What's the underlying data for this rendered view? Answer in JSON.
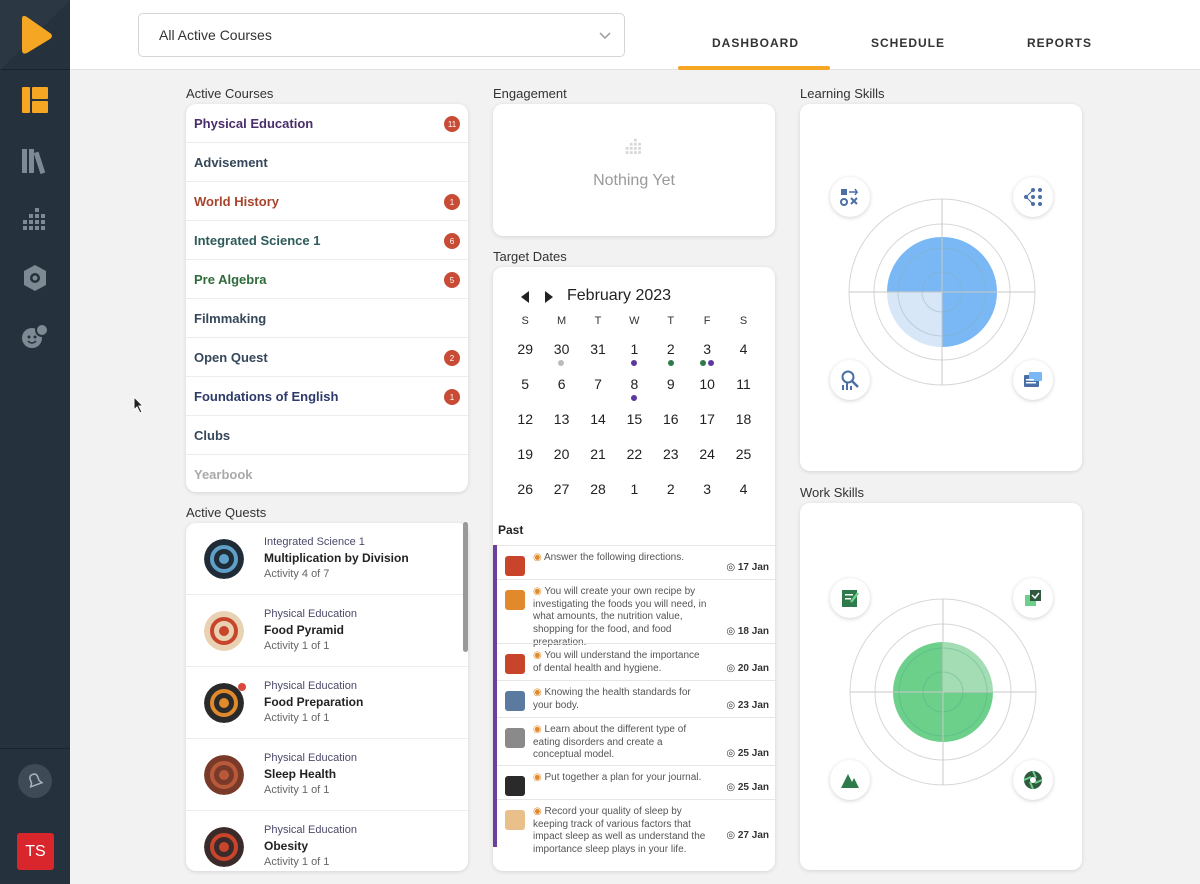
{
  "header": {
    "course_select": "All Active Courses",
    "tabs": [
      {
        "label": "DASHBOARD",
        "active": true
      },
      {
        "label": "SCHEDULE",
        "active": false
      },
      {
        "label": "REPORTS",
        "active": false
      }
    ]
  },
  "sidebar": {
    "avatar_initials": "TS",
    "icons": [
      "dashboard-icon",
      "library-icon",
      "analytics-icon",
      "badge-icon",
      "students-icon",
      "notifications-icon"
    ]
  },
  "active_courses": {
    "title": "Active Courses",
    "items": [
      {
        "name": "Physical Education",
        "badge": "11",
        "color": "#4a2d6a"
      },
      {
        "name": "Advisement",
        "badge": "",
        "color": "#35475a"
      },
      {
        "name": "World History",
        "badge": "1",
        "color": "#a8432c"
      },
      {
        "name": "Integrated Science 1",
        "badge": "6",
        "color": "#2d5a5a"
      },
      {
        "name": "Pre Algebra",
        "badge": "5",
        "color": "#2f6b3a"
      },
      {
        "name": "Filmmaking",
        "badge": "",
        "color": "#35475a"
      },
      {
        "name": "Open Quest",
        "badge": "2",
        "color": "#35475a"
      },
      {
        "name": "Foundations of English",
        "badge": "1",
        "color": "#2d3a6a"
      },
      {
        "name": "Clubs",
        "badge": "",
        "color": "#35475a"
      },
      {
        "name": "Yearbook",
        "badge": "",
        "color": "#aaaaaa"
      }
    ]
  },
  "active_quests": {
    "title": "Active Quests",
    "items": [
      {
        "course": "Integrated Science 1",
        "name": "Multiplication by Division",
        "activity": "Activity 4 of 7"
      },
      {
        "course": "Physical Education",
        "name": "Food Pyramid",
        "activity": "Activity 1 of 1"
      },
      {
        "course": "Physical Education",
        "name": "Food Preparation",
        "activity": "Activity 1 of 1"
      },
      {
        "course": "Physical Education",
        "name": "Sleep Health",
        "activity": "Activity 1 of 1"
      },
      {
        "course": "Physical Education",
        "name": "Obesity",
        "activity": "Activity 1 of 1"
      }
    ]
  },
  "engagement": {
    "title": "Engagement",
    "empty_text": "Nothing Yet"
  },
  "target_dates": {
    "title": "Target Dates",
    "month": "February 2023",
    "weekdays": [
      "S",
      "M",
      "T",
      "W",
      "T",
      "F",
      "S"
    ],
    "weeks": [
      [
        "29",
        "30",
        "31",
        "1",
        "2",
        "3",
        "4"
      ],
      [
        "5",
        "6",
        "7",
        "8",
        "9",
        "10",
        "11"
      ],
      [
        "12",
        "13",
        "14",
        "15",
        "16",
        "17",
        "18"
      ],
      [
        "19",
        "20",
        "21",
        "22",
        "23",
        "24",
        "25"
      ],
      [
        "26",
        "27",
        "28",
        "1",
        "2",
        "3",
        "4"
      ]
    ],
    "past_title": "Past",
    "past": [
      {
        "text": "Answer the following directions.",
        "date": "17 Jan"
      },
      {
        "text": "You will create your own recipe by investigating the foods you will need, in what amounts, the nutrition value, shopping for the food, and food preparation.",
        "date": "18 Jan"
      },
      {
        "text": "You will understand the importance of dental health and hygiene.",
        "date": "20 Jan"
      },
      {
        "text": "Knowing the health standards for your body.",
        "date": "23 Jan"
      },
      {
        "text": "Learn about the different type of eating disorders and create a conceptual model.",
        "date": "25 Jan"
      },
      {
        "text": "Put together a plan for your journal.",
        "date": "25 Jan"
      },
      {
        "text": "Record your quality of sleep by keeping track of various factors that impact sleep as well as understand the importance sleep plays in your life.",
        "date": "27 Jan"
      }
    ]
  },
  "learning_skills": {
    "title": "Learning Skills",
    "color": "#7ab8f5"
  },
  "work_skills": {
    "title": "Work Skills",
    "color": "#6ccf8a"
  }
}
